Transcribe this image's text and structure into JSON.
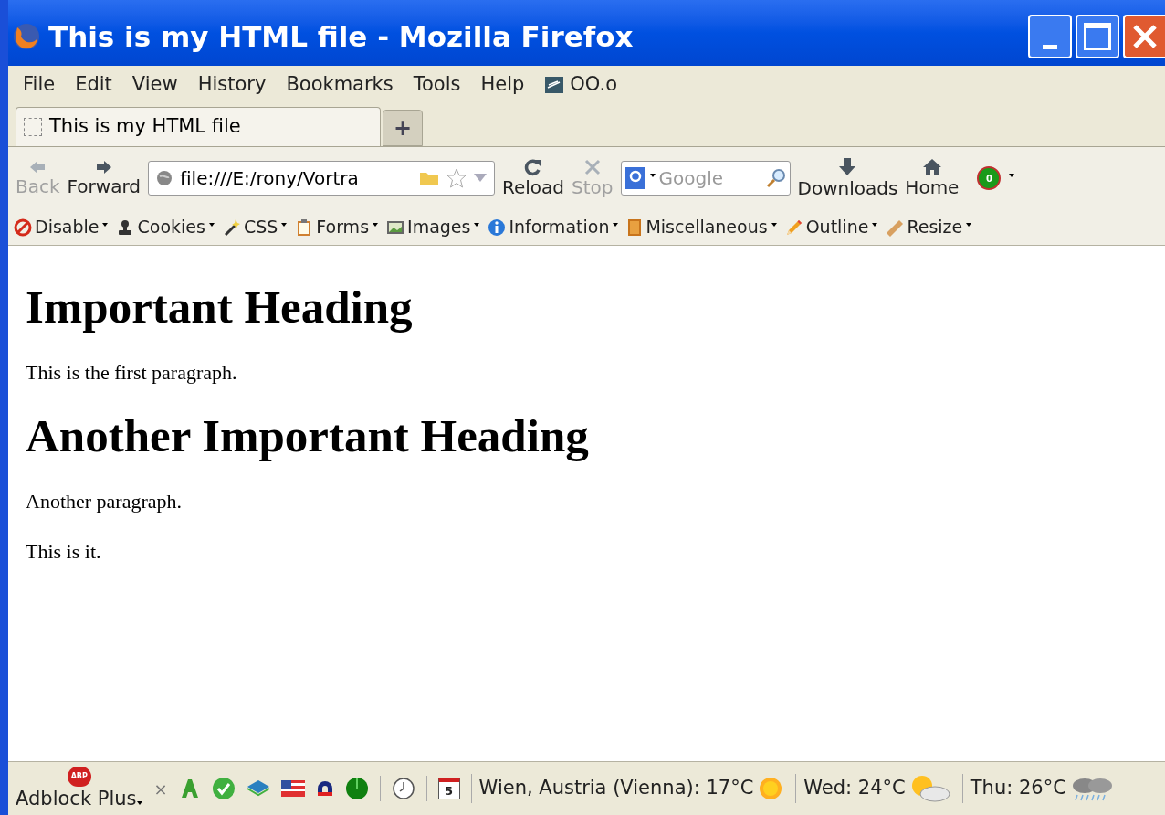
{
  "window": {
    "title": "This is my HTML file - Mozilla Firefox"
  },
  "menu": [
    {
      "label": "File",
      "kind": "menu"
    },
    {
      "label": "Edit",
      "kind": "menu"
    },
    {
      "label": "View",
      "kind": "menu"
    },
    {
      "label": "History",
      "kind": "menu"
    },
    {
      "label": "Bookmarks",
      "kind": "menu"
    },
    {
      "label": "Tools",
      "kind": "menu"
    },
    {
      "label": "Help",
      "kind": "menu"
    },
    {
      "label": "OO.o",
      "kind": "addon"
    }
  ],
  "tabs": [
    {
      "label": "This is my HTML file",
      "selected": true
    }
  ],
  "new_tab": "+",
  "nav": [
    {
      "label": "Back",
      "kind": "back",
      "disabled": true
    },
    {
      "label": "Forward",
      "kind": "forward",
      "disabled": false
    }
  ],
  "address": {
    "value": "file:///E:/rony/Vortra"
  },
  "nav2": [
    {
      "label": "Reload",
      "kind": "reload",
      "disabled": false
    },
    {
      "label": "Stop",
      "kind": "stop",
      "disabled": true
    }
  ],
  "search": {
    "placeholder": "Google"
  },
  "nav3": [
    {
      "label": "Downloads",
      "kind": "downloads"
    },
    {
      "label": "Home",
      "kind": "home"
    }
  ],
  "addon_badge": "0",
  "devtools": [
    {
      "label": "Disable",
      "kind": "disable"
    },
    {
      "label": "Cookies",
      "kind": "cookies"
    },
    {
      "label": "CSS",
      "kind": "css"
    },
    {
      "label": "Forms",
      "kind": "forms"
    },
    {
      "label": "Images",
      "kind": "images"
    },
    {
      "label": "Information",
      "kind": "info"
    },
    {
      "label": "Miscellaneous",
      "kind": "misc"
    },
    {
      "label": "Outline",
      "kind": "outline"
    },
    {
      "label": "Resize",
      "kind": "resize"
    }
  ],
  "content": [
    {
      "kind": "h1",
      "text": "Important Heading"
    },
    {
      "kind": "p",
      "text": "This is the first paragraph."
    },
    {
      "kind": "h1",
      "text": "Another Important Heading"
    },
    {
      "kind": "p",
      "text": "Another paragraph."
    },
    {
      "kind": "p",
      "text": "This is it."
    }
  ],
  "status": {
    "adblock_badge": "ABP",
    "adblock_label": "Adblock Plus",
    "close": "×",
    "calendar_day": "5",
    "weather": [
      {
        "text": "Wien, Austria (Vienna): 17°C",
        "kind": "sun"
      },
      {
        "text": "Wed: 24°C",
        "kind": "partly"
      },
      {
        "text": "Thu: 26°C",
        "kind": "rain"
      }
    ]
  }
}
